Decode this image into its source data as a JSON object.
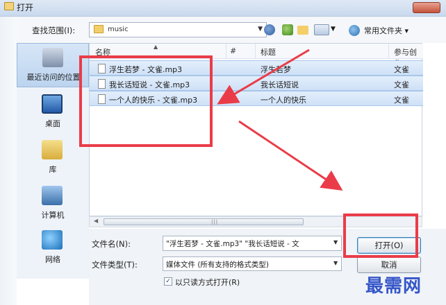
{
  "window": {
    "title": "打开"
  },
  "toolbar": {
    "look_in_label": "查找范围(I):",
    "path": "music",
    "favorites_label": "常用文件夹"
  },
  "places": [
    {
      "label": "最近访问的位置",
      "icon": "recent-places-icon",
      "active": true
    },
    {
      "label": "桌面",
      "icon": "desktop-icon"
    },
    {
      "label": "库",
      "icon": "library-icon"
    },
    {
      "label": "计算机",
      "icon": "computer-icon"
    },
    {
      "label": "网络",
      "icon": "network-icon"
    }
  ],
  "columns": {
    "name": "名称",
    "number": "#",
    "title": "标题",
    "artist": "参与创作"
  },
  "files": [
    {
      "name": "浮生若梦 - 文雀.mp3",
      "title": "浮生若梦",
      "artist": "文雀"
    },
    {
      "name": "我长话短说 - 文雀.mp3",
      "title": "我长话短说",
      "artist": "文雀"
    },
    {
      "name": "一个人的快乐 - 文雀.mp3",
      "title": "一个人的快乐",
      "artist": "文雀"
    }
  ],
  "scrollbar": {
    "grip": "|||"
  },
  "bottom": {
    "filename_label": "文件名(N):",
    "filename_value": "\"浮生若梦 - 文雀.mp3\" \"我长话短说 - 文",
    "filetype_label": "文件类型(T):",
    "filetype_value": "媒体文件 (所有支持的格式类型)",
    "readonly_label": "以只读方式打开(R)",
    "readonly_checked": true,
    "open_button": "打开(O)",
    "cancel_button": "取消"
  },
  "watermark": "最需网",
  "colors": {
    "annotation": "#ea3c48",
    "selection": "#cfe1f7",
    "watermark": "#3556c8"
  }
}
